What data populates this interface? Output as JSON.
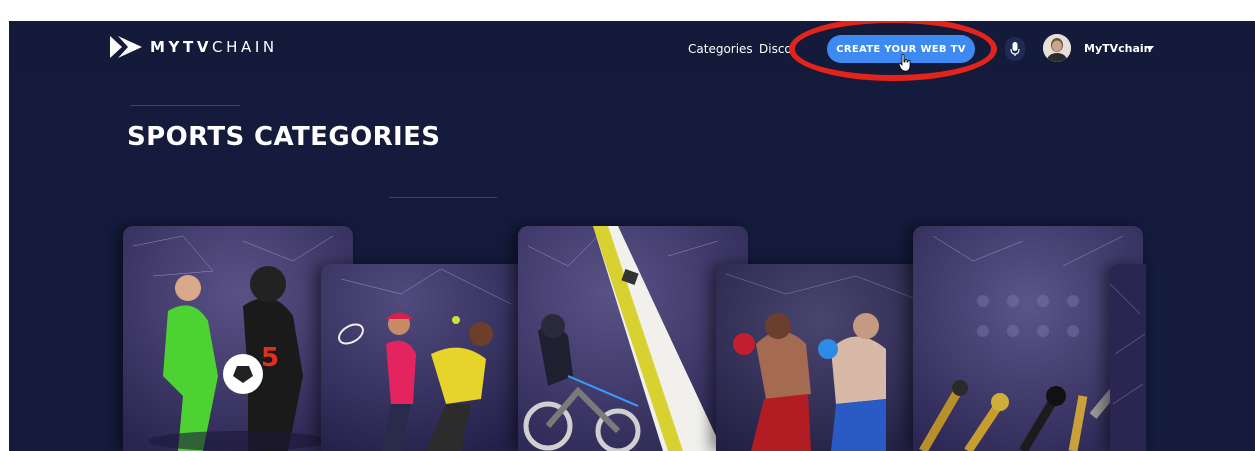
{
  "brand": {
    "name_bold": "MYTV",
    "name_light": "CHAIN"
  },
  "nav": {
    "categories": "Categories",
    "discover": "Disco",
    "cta": "CREATE YOUR WEB TV",
    "user_name": "MyTVchain"
  },
  "page": {
    "title": "SPORTS CATEGORIES"
  },
  "cards": [
    {
      "name": "football-category-card",
      "icon": "soccer-football-players"
    },
    {
      "name": "tennis-category-card",
      "icon": "tennis-players"
    },
    {
      "name": "motorsport-category-card",
      "icon": "motocross-sailing"
    },
    {
      "name": "combat-sports-category-card",
      "icon": "boxing-fighters"
    },
    {
      "name": "media-category-card",
      "icon": "microphones"
    },
    {
      "name": "partial-category-card",
      "icon": "network-pattern"
    }
  ],
  "colors": {
    "background": "#141b3c",
    "cta": "#3d8bf2",
    "highlight": "#e4241a",
    "card_purple": "#3b3461"
  }
}
